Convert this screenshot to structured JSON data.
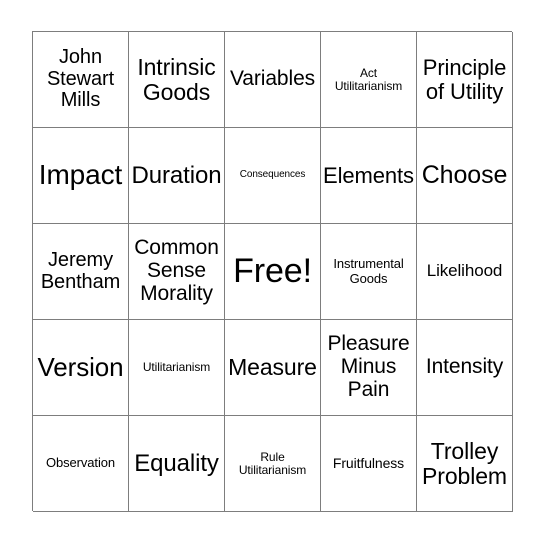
{
  "card": {
    "type": "bingo-card",
    "columns": 5,
    "rows": 5,
    "free_space_index": 12,
    "border_color": "#7d7d7d",
    "background_color": "#ffffff",
    "text_color": "#000000",
    "cells": [
      {
        "text": "John\nStewart\nMills",
        "size": "fs-m"
      },
      {
        "text": "Intrinsic\nGoods",
        "size": "fs-l"
      },
      {
        "text": "Variables",
        "size": "fs-m2"
      },
      {
        "text": "Act\nUtilitarianism",
        "size": "fs-xs"
      },
      {
        "text": "Principle\nof Utility",
        "size": "fs-m3"
      },
      {
        "text": "Impact",
        "size": "fs-xl2"
      },
      {
        "text": "Duration",
        "size": "fs-l2"
      },
      {
        "text": "Consequences",
        "size": "fs-xxs"
      },
      {
        "text": "Elements",
        "size": "fs-m3"
      },
      {
        "text": "Choose",
        "size": "fs-l3"
      },
      {
        "text": "Jeremy\nBentham",
        "size": "fs-m"
      },
      {
        "text": "Common\nSense\nMorality",
        "size": "fs-m2"
      },
      {
        "text": "Free!",
        "size": "fs-free"
      },
      {
        "text": "Instrumental\nGoods",
        "size": "fs-xs2"
      },
      {
        "text": "Likelihood",
        "size": "fs-s2"
      },
      {
        "text": "Version",
        "size": "fs-xl"
      },
      {
        "text": "Utilitarianism",
        "size": "fs-xs"
      },
      {
        "text": "Measure",
        "size": "fs-l"
      },
      {
        "text": "Pleasure\nMinus\nPain",
        "size": "fs-m2"
      },
      {
        "text": "Intensity",
        "size": "fs-m2"
      },
      {
        "text": "Observation",
        "size": "fs-xs2"
      },
      {
        "text": "Equality",
        "size": "fs-l2"
      },
      {
        "text": "Rule\nUtilitarianism",
        "size": "fs-xs"
      },
      {
        "text": "Fruitfulness",
        "size": "fs-s"
      },
      {
        "text": "Trolley\nProblem",
        "size": "fs-l"
      }
    ]
  }
}
